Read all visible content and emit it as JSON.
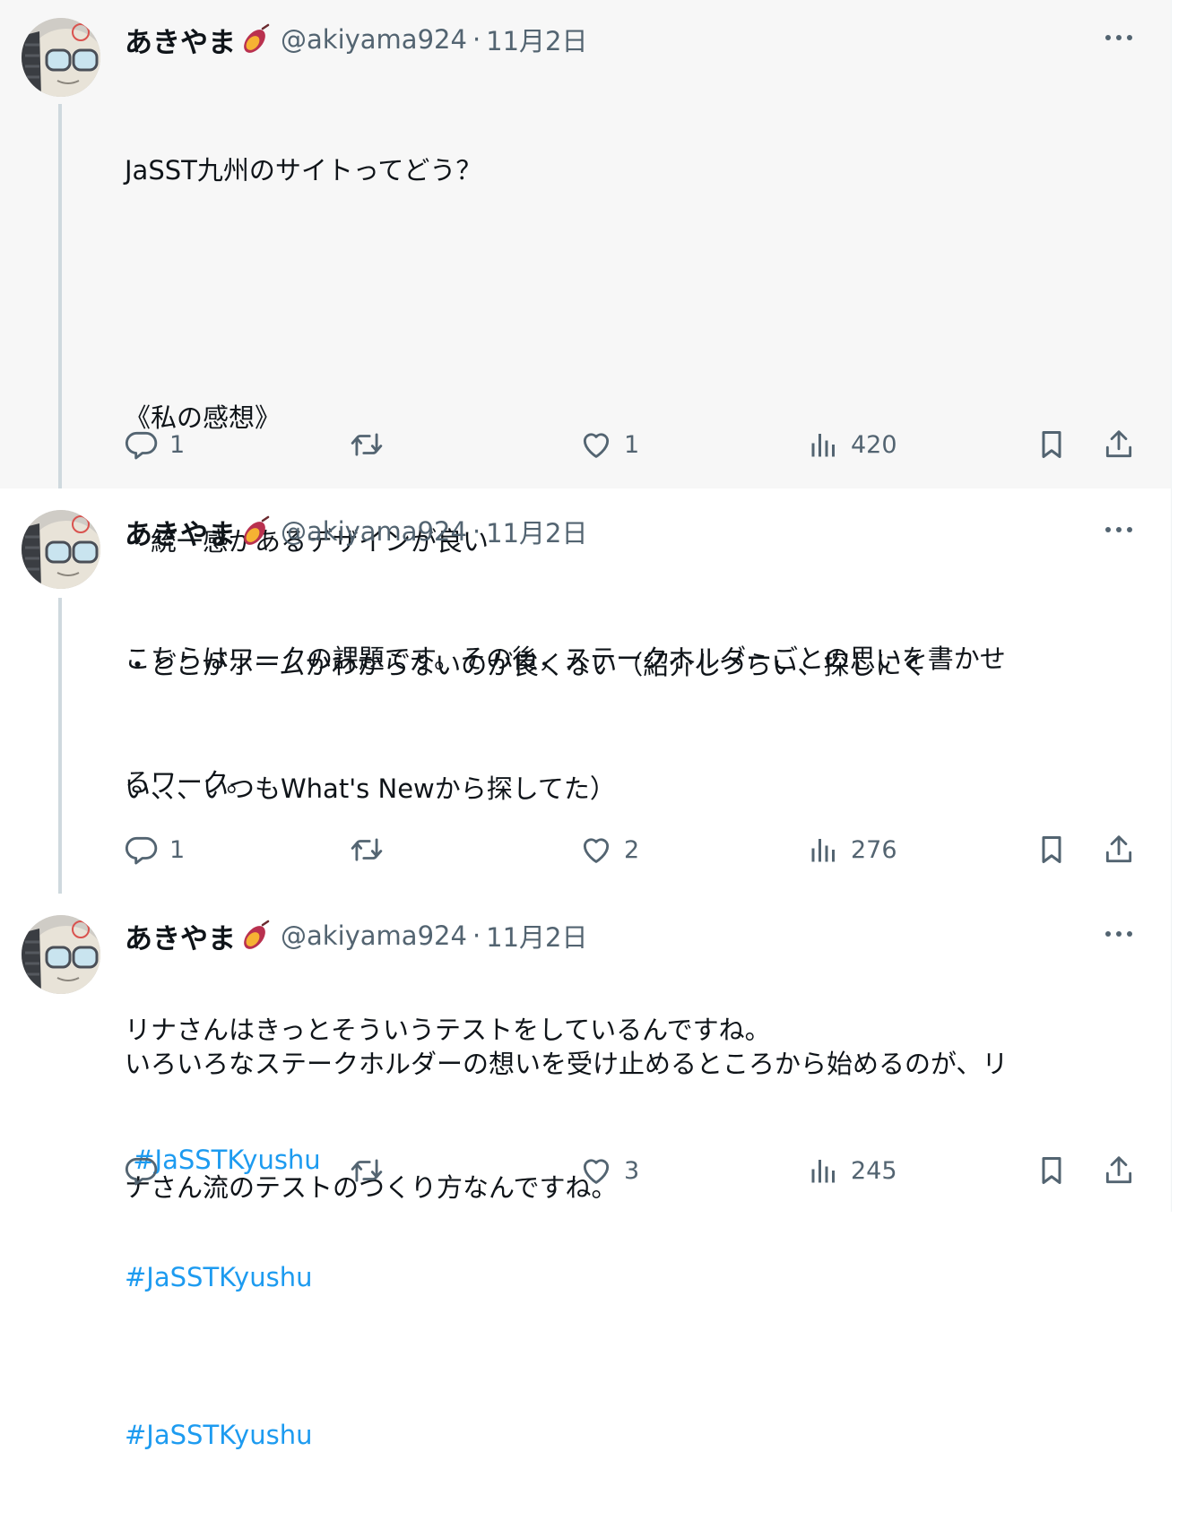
{
  "colors": {
    "accent": "#1d9bf0",
    "text": "#0f1419",
    "muted": "#536471",
    "highlight_bg": "#f7f7f7"
  },
  "icons": {
    "more": "more-dots-icon",
    "reply": "reply-icon",
    "retweet": "retweet-icon",
    "like": "heart-icon",
    "views": "views-bar-icon",
    "bookmark": "bookmark-icon",
    "share": "share-icon",
    "name_badge": "sweet-potato-emoji-icon"
  },
  "tweets": [
    {
      "name": "あきやま",
      "handle": "@akiyama924",
      "sep": "·",
      "date": "11月2日",
      "lines": [
        "JaSST九州のサイトってどう？",
        "",
        "《私の感想》",
        "・統一感があるデザインが良い",
        "・どこがホームかわからないのが良くない（紹介しづらい、探しにく",
        "い、、、いつもWhat's Newから探してた）",
        "",
        ""
      ],
      "hashtag": " #JaSSTKyushu",
      "reply_count": "1",
      "retweet_count": "",
      "like_count": "1",
      "view_count": "420"
    },
    {
      "name": "あきやま",
      "handle": "@akiyama924",
      "sep": "·",
      "date": "11月2日",
      "lines": [
        "こちらはワークの課題です。その後，ステークホルダーごとの思いを書かせ",
        "るワーク。",
        "",
        "リナさんはきっとそういうテストをしているんですね。",
        ""
      ],
      "hashtag": "#JaSSTKyushu",
      "reply_count": "1",
      "retweet_count": "",
      "like_count": "2",
      "view_count": "276"
    },
    {
      "name": "あきやま",
      "handle": "@akiyama924",
      "sep": "·",
      "date": "11月2日",
      "lines": [
        "いろいろなステークホルダーの想いを受け止めるところから始めるのが、リ",
        "ナさん流のテストのつくり方なんですね。",
        ""
      ],
      "hashtag": "#JaSSTKyushu",
      "reply_count": "",
      "retweet_count": "",
      "like_count": "3",
      "view_count": "245"
    }
  ]
}
